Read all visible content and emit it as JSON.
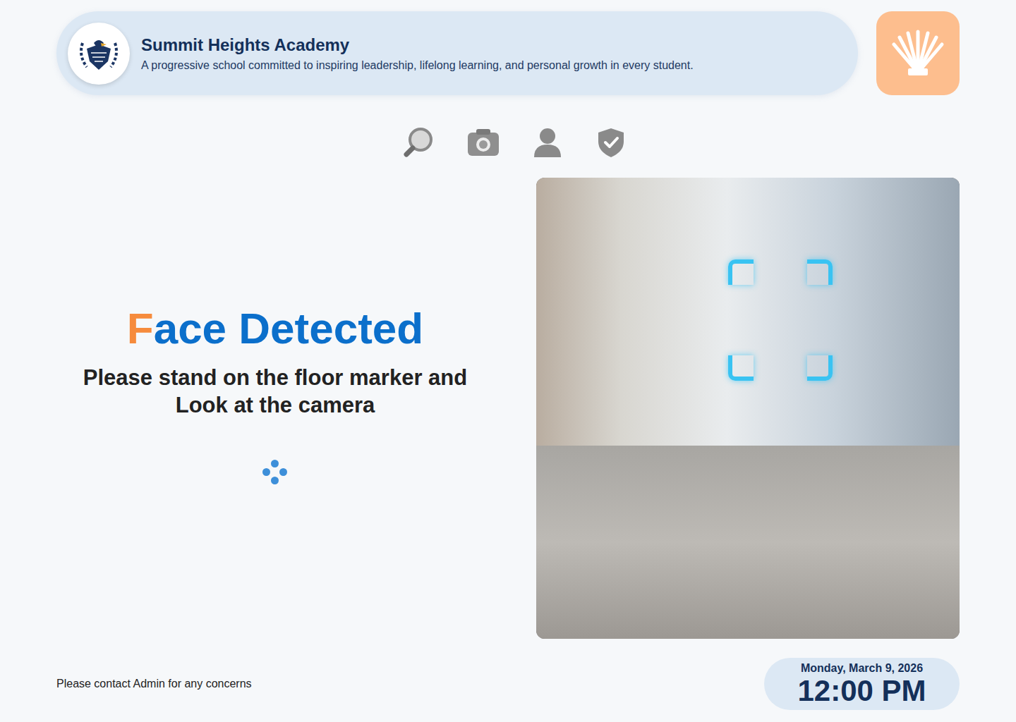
{
  "school": {
    "name": "Summit Heights Academy",
    "tagline": "A progressive school committed to inspiring leadership, lifelong learning, and personal growth in every student."
  },
  "status": {
    "title": "Face Detected",
    "instructions": [
      "Please stand on the floor marker and",
      "Look at the camera"
    ]
  },
  "footer": {
    "note": "Please contact Admin for any concerns"
  },
  "clock": {
    "date": "Monday, March 9, 2026",
    "time": "12:00 PM"
  }
}
